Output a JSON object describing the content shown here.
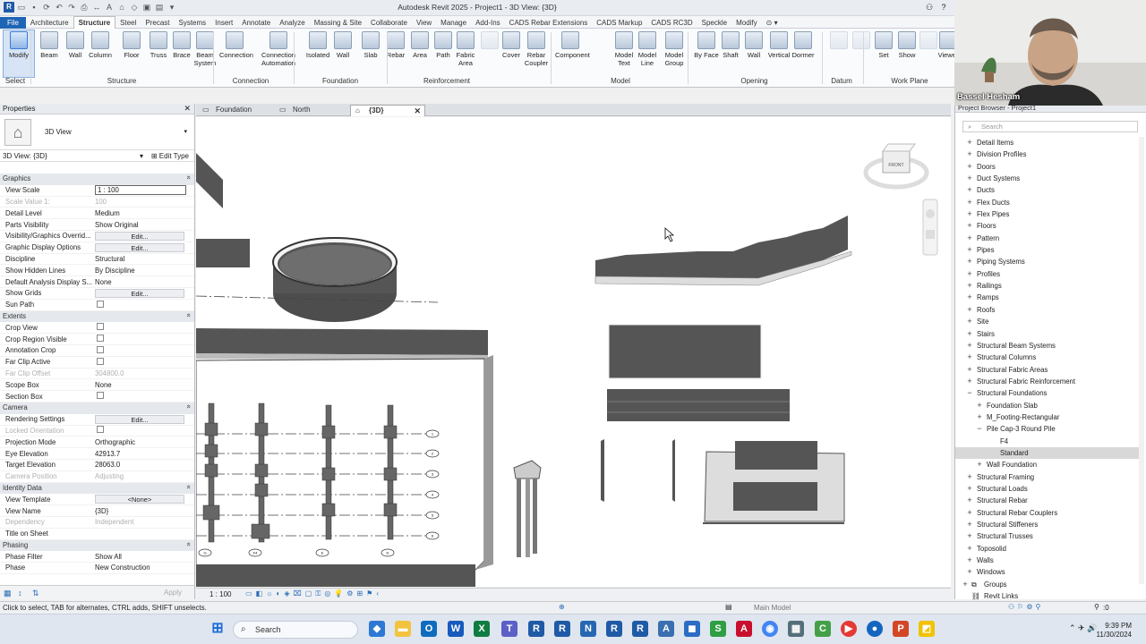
{
  "app": {
    "title": "Autodesk Revit 2025 - Project1 - 3D View: {3D}"
  },
  "ribbon_tabs": [
    "File",
    "Architecture",
    "Structure",
    "Steel",
    "Precast",
    "Systems",
    "Insert",
    "Annotate",
    "Analyze",
    "Massing & Site",
    "Collaborate",
    "View",
    "Manage",
    "Add-Ins",
    "CADS Rebar Extensions",
    "CADS Markup",
    "CADS RC3D",
    "Speckle",
    "Modify"
  ],
  "ribbon": {
    "buttons": [
      {
        "label": "Modify",
        "state": "active"
      },
      {
        "label": "Beam"
      },
      {
        "label": "Wall"
      },
      {
        "label": "Column"
      },
      {
        "label": "Floor"
      },
      {
        "label": "Truss"
      },
      {
        "label": "Brace"
      },
      {
        "label": "Beam System"
      },
      {
        "label": "Connection"
      },
      {
        "label": "Connection Automation"
      },
      {
        "label": "Isolated"
      },
      {
        "label": "Wall"
      },
      {
        "label": "Slab"
      },
      {
        "label": "Rebar"
      },
      {
        "label": "Area"
      },
      {
        "label": "Path"
      },
      {
        "label": "Fabric Area"
      },
      {
        "label": "Cover"
      },
      {
        "label": "Rebar Coupler"
      },
      {
        "label": "Component"
      },
      {
        "label": "Model Text"
      },
      {
        "label": "Model Line"
      },
      {
        "label": "Model Group"
      },
      {
        "label": "By Face"
      },
      {
        "label": "Shaft"
      },
      {
        "label": "Wall"
      },
      {
        "label": "Vertical"
      },
      {
        "label": "Dormer"
      },
      {
        "label": "Set"
      },
      {
        "label": "Show"
      },
      {
        "label": "Viewer"
      }
    ],
    "groups": [
      "Select",
      "Structure",
      "Connection",
      "Foundation",
      "Reinforcement",
      "Model",
      "Opening",
      "Datum",
      "Work Plane"
    ]
  },
  "properties": {
    "panel_title": "Properties",
    "type_name": "3D View",
    "instance_selector": "3D View: {3D}",
    "edit_type": "Edit Type",
    "rows": [
      {
        "kind": "section",
        "label": "Graphics"
      },
      {
        "kind": "input",
        "k": "View Scale",
        "v": "1 : 100"
      },
      {
        "kind": "text",
        "k": "Scale Value    1:",
        "v": "100",
        "gray": true
      },
      {
        "kind": "text",
        "k": "Detail Level",
        "v": "Medium"
      },
      {
        "kind": "text",
        "k": "Parts Visibility",
        "v": "Show Original"
      },
      {
        "kind": "button",
        "k": "Visibility/Graphics Overrid...",
        "v": "Edit..."
      },
      {
        "kind": "button",
        "k": "Graphic Display Options",
        "v": "Edit..."
      },
      {
        "kind": "text",
        "k": "Discipline",
        "v": "Structural"
      },
      {
        "kind": "text",
        "k": "Show Hidden Lines",
        "v": "By Discipline"
      },
      {
        "kind": "text",
        "k": "Default Analysis Display S...",
        "v": "None"
      },
      {
        "kind": "button",
        "k": "Show Grids",
        "v": "Edit..."
      },
      {
        "kind": "check",
        "k": "Sun Path",
        "v": ""
      },
      {
        "kind": "section",
        "label": "Extents"
      },
      {
        "kind": "check",
        "k": "Crop View",
        "v": ""
      },
      {
        "kind": "check",
        "k": "Crop Region Visible",
        "v": ""
      },
      {
        "kind": "check",
        "k": "Annotation Crop",
        "v": ""
      },
      {
        "kind": "check",
        "k": "Far Clip Active",
        "v": ""
      },
      {
        "kind": "text",
        "k": "Far Clip Offset",
        "v": "304800.0",
        "gray": true
      },
      {
        "kind": "text",
        "k": "Scope Box",
        "v": "None"
      },
      {
        "kind": "check",
        "k": "Section Box",
        "v": ""
      },
      {
        "kind": "section",
        "label": "Camera"
      },
      {
        "kind": "button",
        "k": "Rendering Settings",
        "v": "Edit..."
      },
      {
        "kind": "check",
        "k": "Locked Orientation",
        "v": "",
        "gray": true
      },
      {
        "kind": "text",
        "k": "Projection Mode",
        "v": "Orthographic"
      },
      {
        "kind": "text",
        "k": "Eye Elevation",
        "v": "42913.7"
      },
      {
        "kind": "text",
        "k": "Target Elevation",
        "v": "28063.0"
      },
      {
        "kind": "text",
        "k": "Camera Position",
        "v": "Adjusting",
        "gray": true
      },
      {
        "kind": "section",
        "label": "Identity Data"
      },
      {
        "kind": "button",
        "k": "View Template",
        "v": "<None>"
      },
      {
        "kind": "text",
        "k": "View Name",
        "v": "{3D}"
      },
      {
        "kind": "text",
        "k": "Dependency",
        "v": "Independent",
        "gray": true
      },
      {
        "kind": "text",
        "k": "Title on Sheet",
        "v": ""
      },
      {
        "kind": "section",
        "label": "Phasing"
      },
      {
        "kind": "text",
        "k": "Phase Filter",
        "v": "Show All"
      },
      {
        "kind": "text",
        "k": "Phase",
        "v": "New Construction"
      }
    ],
    "apply": "Apply"
  },
  "view_tabs": [
    {
      "label": "Foundation",
      "active": false
    },
    {
      "label": "North",
      "active": false
    },
    {
      "label": "{3D}",
      "active": true
    }
  ],
  "viewcube_label": "FRONT",
  "view_scale_footer": "1 : 100",
  "grid_bubbles": [
    "1",
    "2",
    "3",
    "4",
    "5",
    "6",
    "7"
  ],
  "column_bubbles": [
    "G",
    "F4",
    "E",
    "D"
  ],
  "project_browser": {
    "title": "Project Browser - Project1",
    "search_placeholder": "Search",
    "items": [
      {
        "label": "Detail Items",
        "level": 1,
        "sym": "+"
      },
      {
        "label": "Division Profiles",
        "level": 1,
        "sym": "+"
      },
      {
        "label": "Doors",
        "level": 1,
        "sym": "+"
      },
      {
        "label": "Duct Systems",
        "level": 1,
        "sym": "+"
      },
      {
        "label": "Ducts",
        "level": 1,
        "sym": "+"
      },
      {
        "label": "Flex Ducts",
        "level": 1,
        "sym": "+"
      },
      {
        "label": "Flex Pipes",
        "level": 1,
        "sym": "+"
      },
      {
        "label": "Floors",
        "level": 1,
        "sym": "+"
      },
      {
        "label": "Pattern",
        "level": 1,
        "sym": "+"
      },
      {
        "label": "Pipes",
        "level": 1,
        "sym": "+"
      },
      {
        "label": "Piping Systems",
        "level": 1,
        "sym": "+"
      },
      {
        "label": "Profiles",
        "level": 1,
        "sym": "+"
      },
      {
        "label": "Railings",
        "level": 1,
        "sym": "+"
      },
      {
        "label": "Ramps",
        "level": 1,
        "sym": "+"
      },
      {
        "label": "Roofs",
        "level": 1,
        "sym": "+"
      },
      {
        "label": "Site",
        "level": 1,
        "sym": "+"
      },
      {
        "label": "Stairs",
        "level": 1,
        "sym": "+"
      },
      {
        "label": "Structural Beam Systems",
        "level": 1,
        "sym": "+"
      },
      {
        "label": "Structural Columns",
        "level": 1,
        "sym": "+"
      },
      {
        "label": "Structural Fabric Areas",
        "level": 1,
        "sym": "+"
      },
      {
        "label": "Structural Fabric Reinforcement",
        "level": 1,
        "sym": "+"
      },
      {
        "label": "Structural Foundations",
        "level": 1,
        "sym": "−"
      },
      {
        "label": "Foundation Slab",
        "level": 2,
        "sym": "+"
      },
      {
        "label": "M_Footing-Rectangular",
        "level": 2,
        "sym": "+"
      },
      {
        "label": "Pile Cap-3 Round Pile",
        "level": 2,
        "sym": "−"
      },
      {
        "label": "F4",
        "level": 3,
        "sym": ""
      },
      {
        "label": "Standard",
        "level": 3,
        "sym": "",
        "selected": true
      },
      {
        "label": "Wall Foundation",
        "level": 2,
        "sym": "+"
      },
      {
        "label": "Structural Framing",
        "level": 1,
        "sym": "+"
      },
      {
        "label": "Structural Loads",
        "level": 1,
        "sym": "+"
      },
      {
        "label": "Structural Rebar",
        "level": 1,
        "sym": "+"
      },
      {
        "label": "Structural Rebar Couplers",
        "level": 1,
        "sym": "+"
      },
      {
        "label": "Structural Stiffeners",
        "level": 1,
        "sym": "+"
      },
      {
        "label": "Structural Trusses",
        "level": 1,
        "sym": "+"
      },
      {
        "label": "Toposolid",
        "level": 1,
        "sym": "+"
      },
      {
        "label": "Walls",
        "level": 1,
        "sym": "+"
      },
      {
        "label": "Windows",
        "level": 1,
        "sym": "+"
      },
      {
        "label": "Groups",
        "level": 0,
        "sym": "+"
      },
      {
        "label": "Revit Links",
        "level": 0,
        "sym": ""
      }
    ]
  },
  "status": {
    "hint": "Click to select, TAB for alternates, CTRL adds, SHIFT unselects.",
    "model": "Main Model",
    "filter_count": ":0"
  },
  "taskbar": {
    "search_placeholder": "Search",
    "time": "9:39 PM",
    "date": "11/30/2024"
  },
  "webcam": {
    "presenter": "Bassel Hesham"
  }
}
